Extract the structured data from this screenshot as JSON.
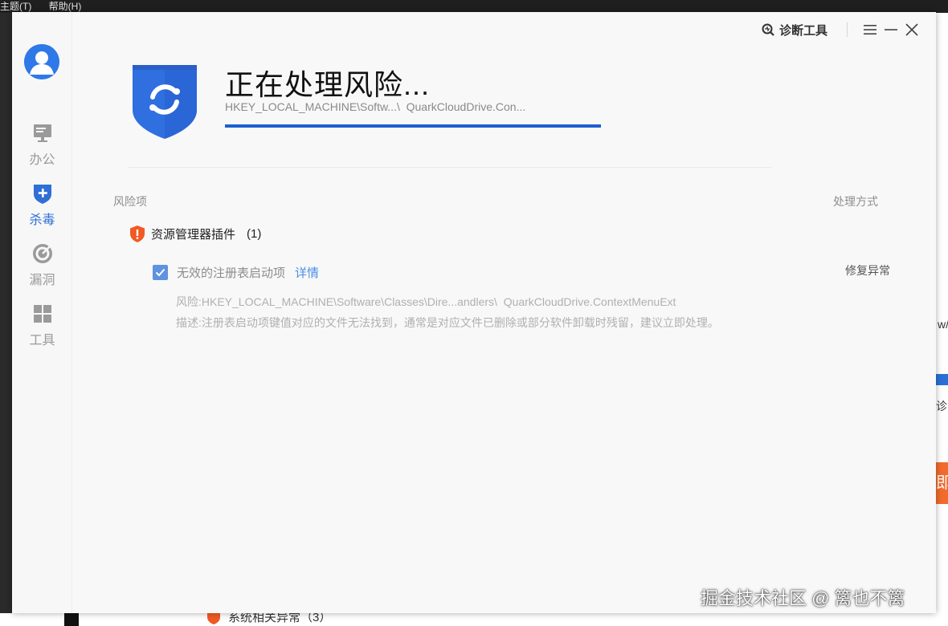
{
  "background": {
    "menubar": [
      "主题(T)",
      "帮助(H)"
    ],
    "right_text_w": "w/",
    "right_text_d": "诊",
    "right_orange": "即",
    "bottom_item": "系统相关异常（3）"
  },
  "sidebar": {
    "avatar_icon": "user-avatar-icon",
    "items": [
      {
        "label": "办公",
        "icon": "monitor-icon",
        "active": false
      },
      {
        "label": "杀毒",
        "icon": "shield-plus-icon",
        "active": true
      },
      {
        "label": "漏洞",
        "icon": "target-icon",
        "active": false
      },
      {
        "label": "工具",
        "icon": "grid-icon",
        "active": false
      }
    ]
  },
  "topbar": {
    "diag_tool": "诊断工具",
    "menu_icon": "hamburger-icon",
    "minimize_icon": "minimize-icon",
    "close_icon": "close-icon"
  },
  "status": {
    "title": "正在处理风险...",
    "path": "HKEY_LOCAL_MACHINE\\Softw...\\  QuarkCloudDrive.Con...",
    "progress": 1.0
  },
  "table": {
    "col_risk": "风险项",
    "col_method": "处理方式"
  },
  "group": {
    "name": "资源管理器插件",
    "count": "(1)"
  },
  "item": {
    "checked": true,
    "name": "无效的注册表启动项",
    "detail_link": "详情",
    "action": "修复异常",
    "risk": "风险:HKEY_LOCAL_MACHINE\\Software\\Classes\\Dire...andlers\\  QuarkCloudDrive.ContextMenuExt",
    "desc": "描述:注册表启动项键值对应的文件无法找到，通常是对应文件已删除或部分软件卸载时残留，建议立即处理。"
  },
  "watermark": "掘金技术社区 @ 篱也不篱",
  "colors": {
    "accent": "#2f6fd6",
    "progress": "#1e5fd0",
    "warning": "#f05a24",
    "link": "#4a8fe7"
  }
}
